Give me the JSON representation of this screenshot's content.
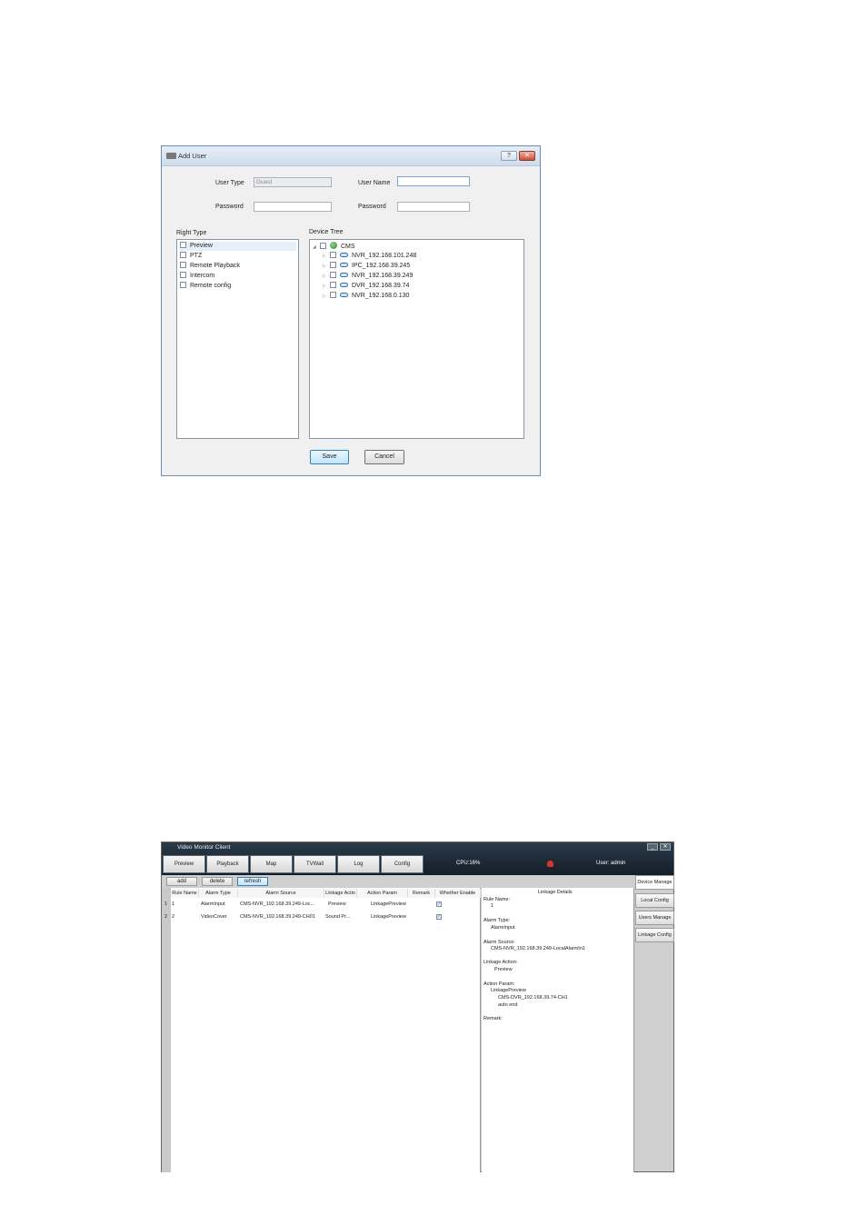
{
  "add_user": {
    "title": "Add User",
    "help": "?",
    "close": "✕",
    "user_type_label": "User Type",
    "user_type_value": "Guest",
    "user_name_label": "User Name",
    "user_name_value": "",
    "password_label": "Password",
    "confirm_password_label": "Password",
    "right_type_label": "Right Type",
    "rights": [
      "Preview",
      "PTZ",
      "Remote Playback",
      "Intercom",
      "Remote config"
    ],
    "device_tree_label": "Device Tree",
    "tree_root": "CMS",
    "tree_devices": [
      "NVR_192.168.101.248",
      "IPC_192.168.39.245",
      "NVR_192.168.39.249",
      "DVR_192.168.39.74",
      "NVR_192.168.0.130"
    ],
    "save": "Save",
    "cancel": "Cancel"
  },
  "client": {
    "title": "Video Monitor Client",
    "min": "_",
    "close": "✕",
    "tabs": [
      "Preview",
      "Playback",
      "Map",
      "TVWall",
      "Log",
      "Config"
    ],
    "cpu": "CPU:16%",
    "user": "User: admin",
    "toolbar": {
      "add": "add",
      "delete": "delete",
      "refresh": "refresh"
    },
    "columns": [
      "Rule Name",
      "Alarm Type",
      "Alarm Source",
      "Linkage Actio",
      "Action Param",
      "Remark",
      "Whether Enable"
    ],
    "rows": [
      {
        "num": "1",
        "rule": "1",
        "type": "AlarmInput",
        "source": "CMS-NVR_192.168.39.249-Loc...",
        "action": "Preview",
        "param": "LinkagePreview",
        "remark": "",
        "enable": "✓"
      },
      {
        "num": "2",
        "rule": "2",
        "type": "VideoCover",
        "source": "CMS-NVR_192.168.39.249-CH01",
        "action": "Sound  Pr...",
        "param": "LinkagePreview",
        "remark": "",
        "enable": "✓"
      }
    ],
    "details": {
      "heading": "Linkage Details",
      "rule_name_label": "Rule Name:",
      "rule_name": "1",
      "alarm_type_label": "Alarm Type:",
      "alarm_type": "AlarmInput",
      "alarm_source_label": "Alarm Source:",
      "alarm_source": "CMS-NVR_192.168.39.249-LocalAlarmIn1",
      "linkage_action_label": "Linkage Action:",
      "linkage_action": "Preview",
      "action_param_label": "Action Param:",
      "action_param_1": "LinkagePreview",
      "action_param_2": "CMS-DVR_192.168.39.74-CH1",
      "action_param_3": "auto end",
      "remark_label": "Remark:"
    },
    "side_nav": [
      "Device Manage",
      "Local Config",
      "Users Manage",
      "Linkage Config"
    ]
  }
}
